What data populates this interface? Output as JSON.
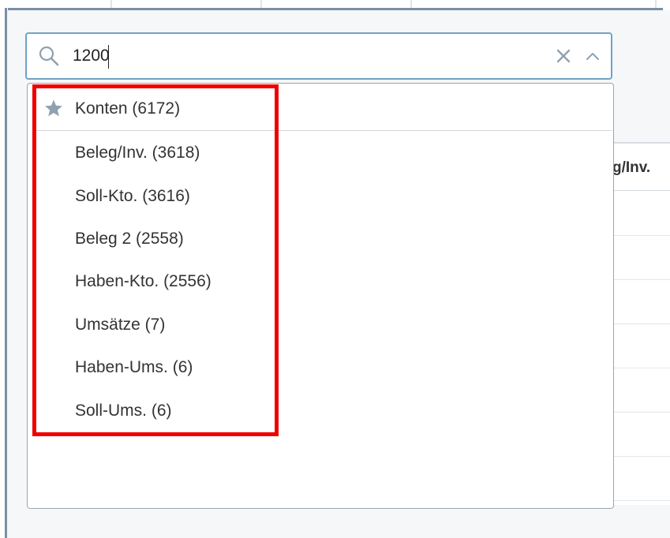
{
  "search": {
    "value": "1200",
    "placeholder": ""
  },
  "table": {
    "header_label": "g/Inv."
  },
  "dropdown": {
    "header": {
      "label": "Konten (6172)",
      "icon": "star-icon"
    },
    "items": [
      {
        "label": "Beleg/Inv. (3618)"
      },
      {
        "label": "Soll-Kto. (3616)"
      },
      {
        "label": "Beleg 2 (2558)"
      },
      {
        "label": "Haben-Kto. (2556)"
      },
      {
        "label": "Umsätze (7)"
      },
      {
        "label": "Haben-Ums. (6)"
      },
      {
        "label": "Soll-Ums. (6)"
      }
    ]
  },
  "colors": {
    "focus_border": "#6fa4c4",
    "highlight": "#ee0000",
    "frame": "#7a8fa3",
    "icon_gray": "#8fa1b0"
  }
}
